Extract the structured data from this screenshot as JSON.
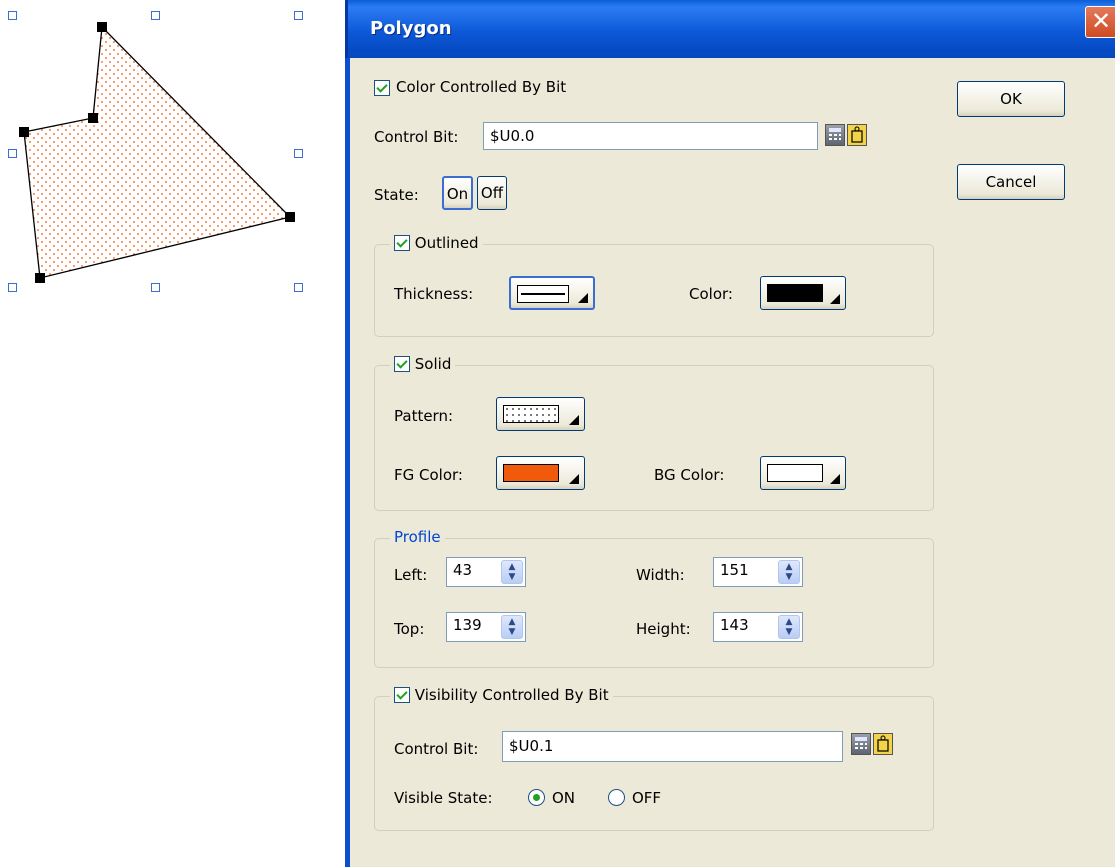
{
  "dialog": {
    "title": "Polygon",
    "close_glyph": "✕",
    "ok_label": "OK",
    "cancel_label": "Cancel",
    "color_bit": {
      "checkbox_label": "Color Controlled By Bit",
      "control_bit_label": "Control Bit:",
      "control_bit_value": "$U0.0",
      "state_label": "State:",
      "state_on_label": "On",
      "state_off_label": "Off"
    },
    "outlined": {
      "legend": "Outlined",
      "thickness_label": "Thickness:",
      "color_label": "Color:",
      "color_value": "#000000"
    },
    "solid": {
      "legend": "Solid",
      "pattern_label": "Pattern:",
      "fg_color_label": "FG Color:",
      "fg_color_value": "#f05a0a",
      "bg_color_label": "BG Color:",
      "bg_color_value": "#ffffff"
    },
    "profile": {
      "legend": "Profile",
      "left_label": "Left:",
      "left_value": "43",
      "top_label": "Top:",
      "top_value": "139",
      "width_label": "Width:",
      "width_value": "151",
      "height_label": "Height:",
      "height_value": "143"
    },
    "visibility": {
      "checkbox_label": "Visibility Controlled By Bit",
      "control_bit_label": "Control Bit:",
      "control_bit_value": "$U0.1",
      "visible_state_label": "Visible State:",
      "on_label": "ON",
      "off_label": "OFF",
      "selected": "ON"
    }
  },
  "canvas": {
    "shape": "polygon",
    "fill_color": "#f05a0a"
  },
  "icons": {
    "calculator": "calculator-icon",
    "tag_browse": "tag-browse-icon",
    "close": "close-icon",
    "spin": "spin-updown-icon"
  }
}
